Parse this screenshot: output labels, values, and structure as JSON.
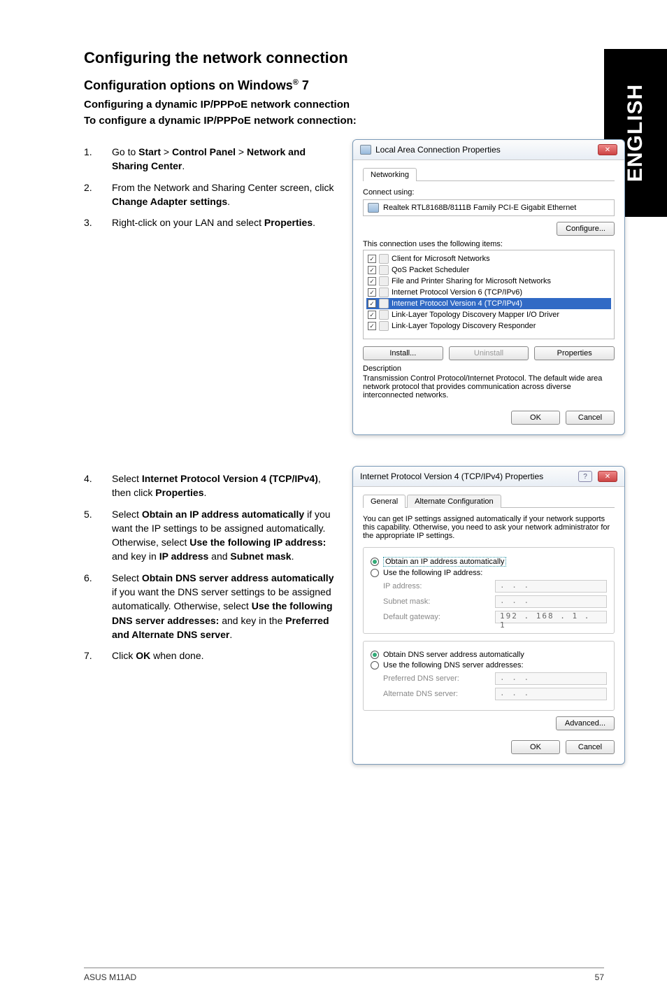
{
  "side_tab": "ENGLISH",
  "h1": "Configuring the network connection",
  "h2_prefix": "Configuration options on Windows",
  "h2_suffix": " 7",
  "bold1": "Configuring a dynamic IP/PPPoE network connection",
  "bold2": "To configure a dynamic IP/PPPoE network connection:",
  "steps_top": [
    {
      "n": "1.",
      "html": "Go to <b>Start</b> > <b>Control Panel</b> > <b>Network and Sharing Center</b>."
    },
    {
      "n": "2.",
      "html": "From the Network and Sharing Center screen, click <b>Change Adapter settings</b>."
    },
    {
      "n": "3.",
      "html": "Right-click on your LAN and select <b>Properties</b>."
    }
  ],
  "steps_bottom": [
    {
      "n": "4.",
      "html": "Select <b>Internet Protocol Version 4 (TCP/IPv4)</b>, then click <b>Properties</b>."
    },
    {
      "n": "5.",
      "html": "Select <b>Obtain an IP address automatically</b> if you want the IP settings to be assigned automatically. Otherwise, select <b>Use the following IP address:</b> and key in <b>IP address</b> and <b>Subnet mask</b>."
    },
    {
      "n": "6.",
      "html": "Select <b>Obtain DNS server address automatically</b> if you want the DNS server settings to be assigned automatically. Otherwise, select <b>Use the following DNS server addresses:</b> and key in the <b>Preferred and Alternate DNS server</b>."
    },
    {
      "n": "7.",
      "html": "Click <b>OK</b> when done."
    }
  ],
  "dialog1": {
    "title": "Local Area Connection Properties",
    "tab": "Networking",
    "connect_using": "Connect using:",
    "adapter": "Realtek RTL8168B/8111B Family PCI-E Gigabit Ethernet",
    "configure": "Configure...",
    "uses_items": "This connection uses the following items:",
    "items": [
      "Client for Microsoft Networks",
      "QoS Packet Scheduler",
      "File and Printer Sharing for Microsoft Networks",
      "Internet Protocol Version 6 (TCP/IPv6)",
      "Internet Protocol Version 4 (TCP/IPv4)",
      "Link-Layer Topology Discovery Mapper I/O Driver",
      "Link-Layer Topology Discovery Responder"
    ],
    "install": "Install...",
    "uninstall": "Uninstall",
    "properties": "Properties",
    "desc_label": "Description",
    "desc_text": "Transmission Control Protocol/Internet Protocol. The default wide area network protocol that provides communication across diverse interconnected networks.",
    "ok": "OK",
    "cancel": "Cancel"
  },
  "dialog2": {
    "title": "Internet Protocol Version 4 (TCP/IPv4) Properties",
    "tab1": "General",
    "tab2": "Alternate Configuration",
    "intro": "You can get IP settings assigned automatically if your network supports this capability. Otherwise, you need to ask your network administrator for the appropriate IP settings.",
    "r1": "Obtain an IP address automatically",
    "r2": "Use the following IP address:",
    "ip_label": "IP address:",
    "subnet_label": "Subnet mask:",
    "gateway_label": "Default gateway:",
    "gateway_val": "192 . 168 .  1  .  1",
    "r3": "Obtain DNS server address automatically",
    "r4": "Use the following DNS server addresses:",
    "pref_label": "Preferred DNS server:",
    "alt_label": "Alternate DNS server:",
    "advanced": "Advanced...",
    "ok": "OK",
    "cancel": "Cancel",
    "dots": ".      .      ."
  },
  "footer_left": "ASUS M11AD",
  "footer_right": "57"
}
